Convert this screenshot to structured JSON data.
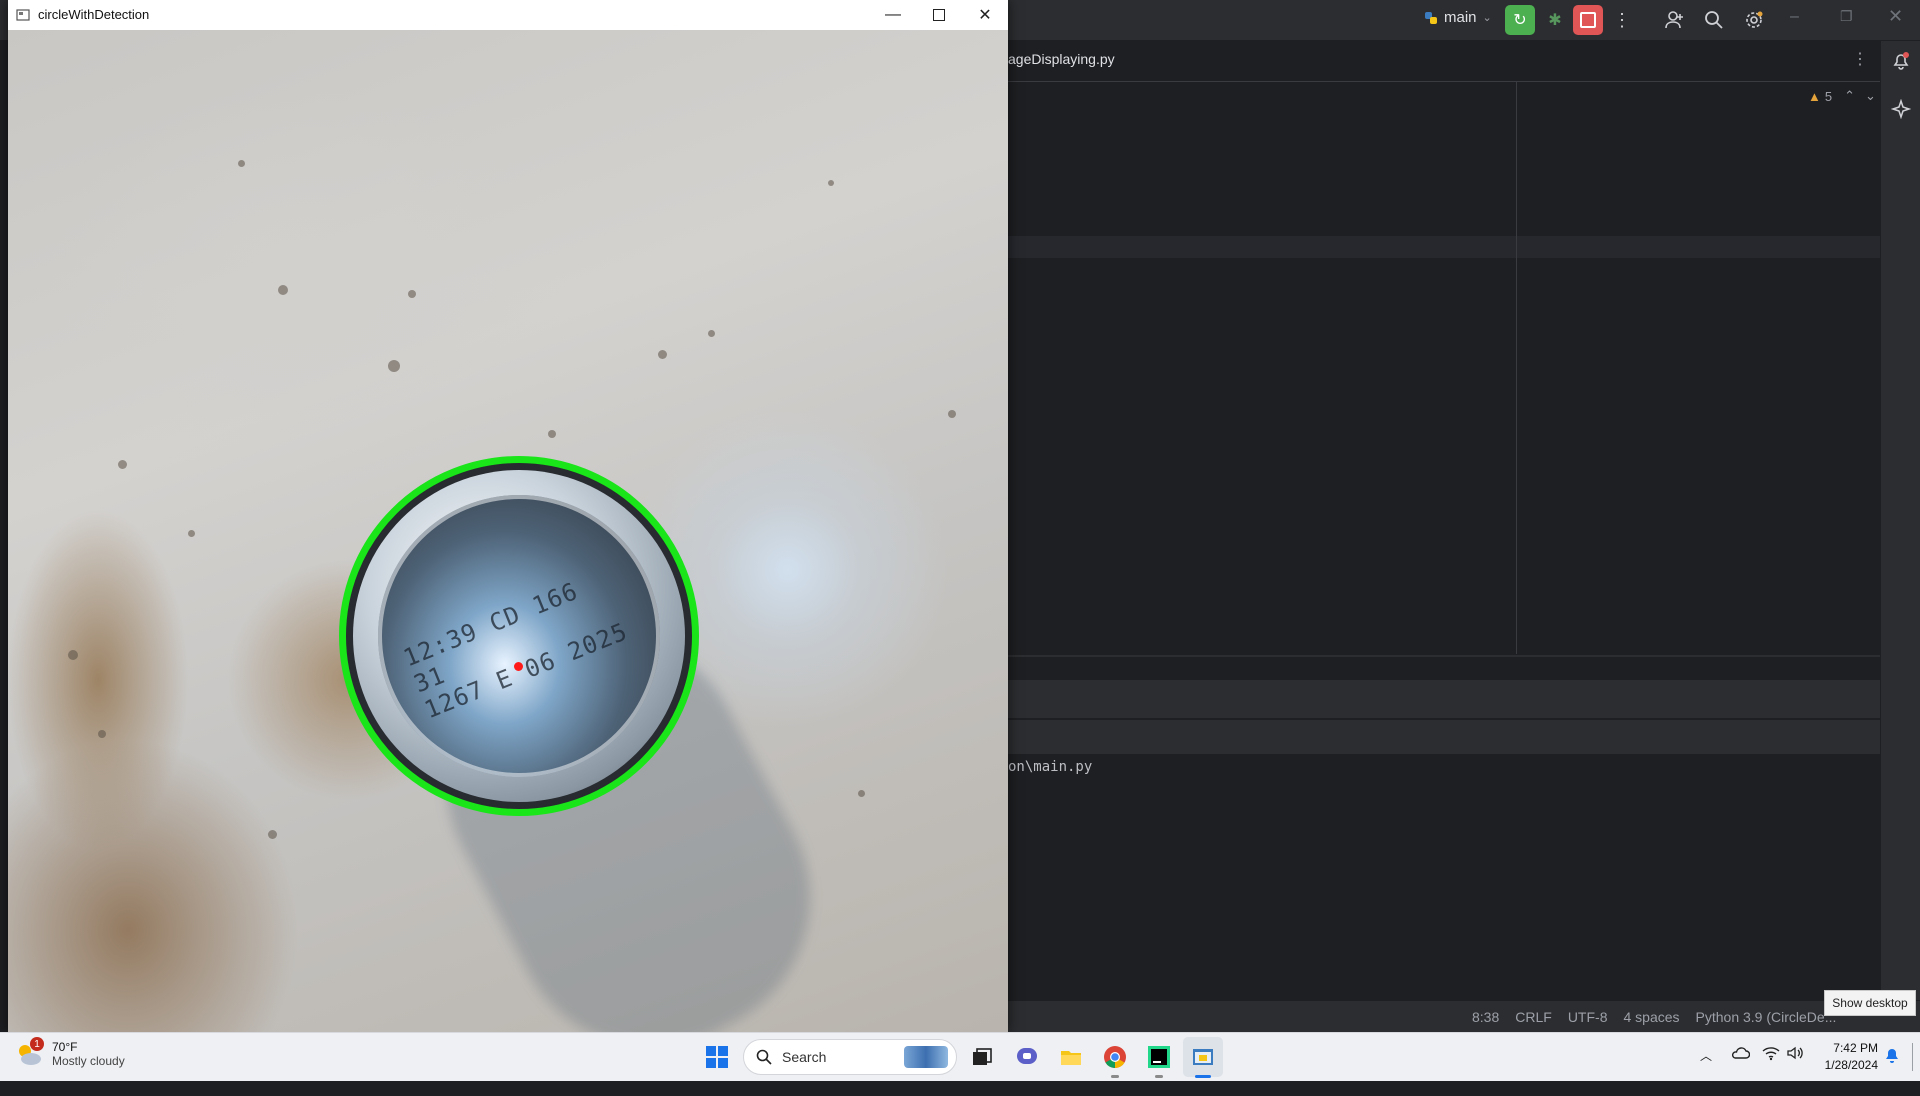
{
  "ide": {
    "branch": "main",
    "editor_tab": "ageDisplaying.py",
    "warnings_count": "5",
    "console_line": "on\\main.py",
    "status": {
      "position": "8:38",
      "line_endings": "CRLF",
      "encoding": "UTF-8",
      "indent": "4 spaces",
      "interpreter": "Python 3.9 (CircleDe..."
    }
  },
  "image_window": {
    "title": "circleWithDetection",
    "can_code_line1": "12:39 CD 166 31",
    "can_code_line2": "1267 E 06 2025"
  },
  "taskbar": {
    "weather_temp": "70°F",
    "weather_desc": "Mostly cloudy",
    "weather_badge": "1",
    "search_placeholder": "Search",
    "time": "7:42 PM",
    "date": "1/28/2024",
    "show_desktop_tooltip": "Show desktop"
  },
  "colors": {
    "detection_circle": "#19e519",
    "center_point": "#ff1a1a",
    "run_button": "#4caf50",
    "stop_button": "#e05555"
  }
}
